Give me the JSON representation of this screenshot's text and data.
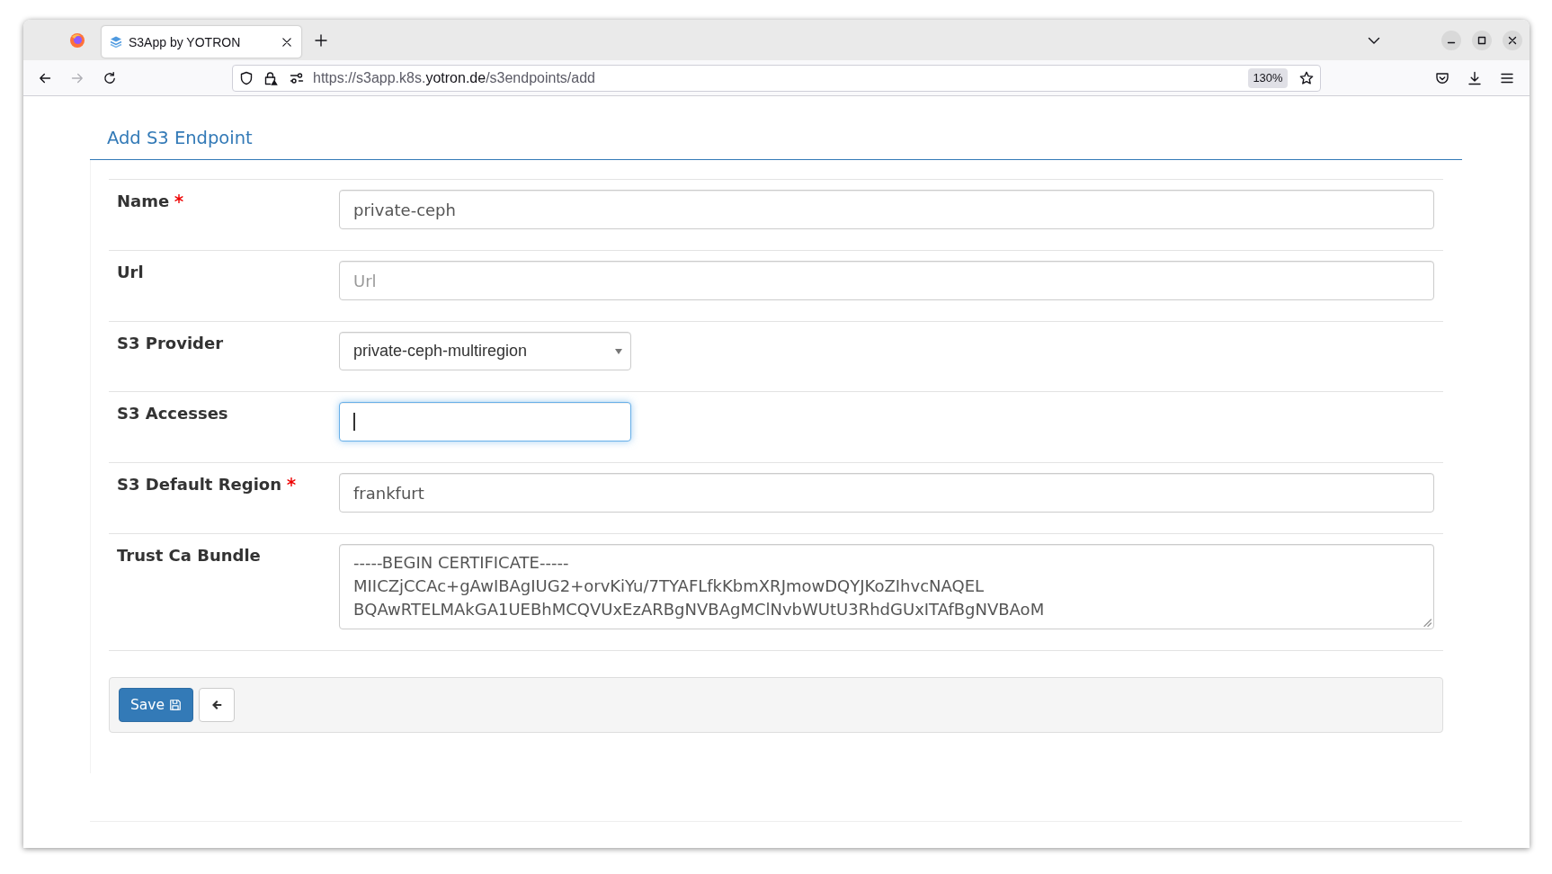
{
  "browser": {
    "tabs": [
      {
        "title": "S3App by YOTRON",
        "selected": true
      }
    ],
    "nav_buttons": [
      {
        "kind": "back",
        "disabled": false
      },
      {
        "kind": "forward",
        "disabled": true
      },
      {
        "kind": "reload",
        "disabled": false
      }
    ],
    "address": {
      "scheme_and_subdomain": "https://s3app.k8s.",
      "domain": "yotron.de",
      "path": "/s3endpoints/add"
    },
    "zoom_level": "130%"
  },
  "page": {
    "title": "Add S3 Endpoint",
    "fields": [
      {
        "kind": "text",
        "label": "Name",
        "required": true,
        "focused": false,
        "value": "private-ceph"
      },
      {
        "kind": "text",
        "label": "Url",
        "required": false,
        "focused": false,
        "placeholder": "Url"
      },
      {
        "kind": "select",
        "label": "S3 Provider",
        "required": false,
        "focused": false,
        "value": "private-ceph-multiregion"
      },
      {
        "kind": "tags",
        "label": "S3 Accesses",
        "required": false,
        "focused": true
      },
      {
        "kind": "text",
        "label": "S3 Default Region",
        "required": true,
        "focused": false,
        "value": "frankfurt"
      },
      {
        "kind": "textarea",
        "label": "Trust Ca Bundle",
        "required": false,
        "focused": false,
        "value": "-----BEGIN CERTIFICATE-----\nMIICZjCCAc+gAwIBAgIUG2+orvKiYu/7TYAFLfkKbmXRJmowDQYJKoZIhvcNAQEL\nBQAwRTELMAkGA1UEBhMCQVUxEzARBgNVBAgMClNvbWUtU3RhdGUxITAfBgNVBAoM"
      }
    ],
    "buttons": [
      {
        "kind": "save",
        "label": "Save"
      },
      {
        "kind": "back"
      }
    ]
  }
}
